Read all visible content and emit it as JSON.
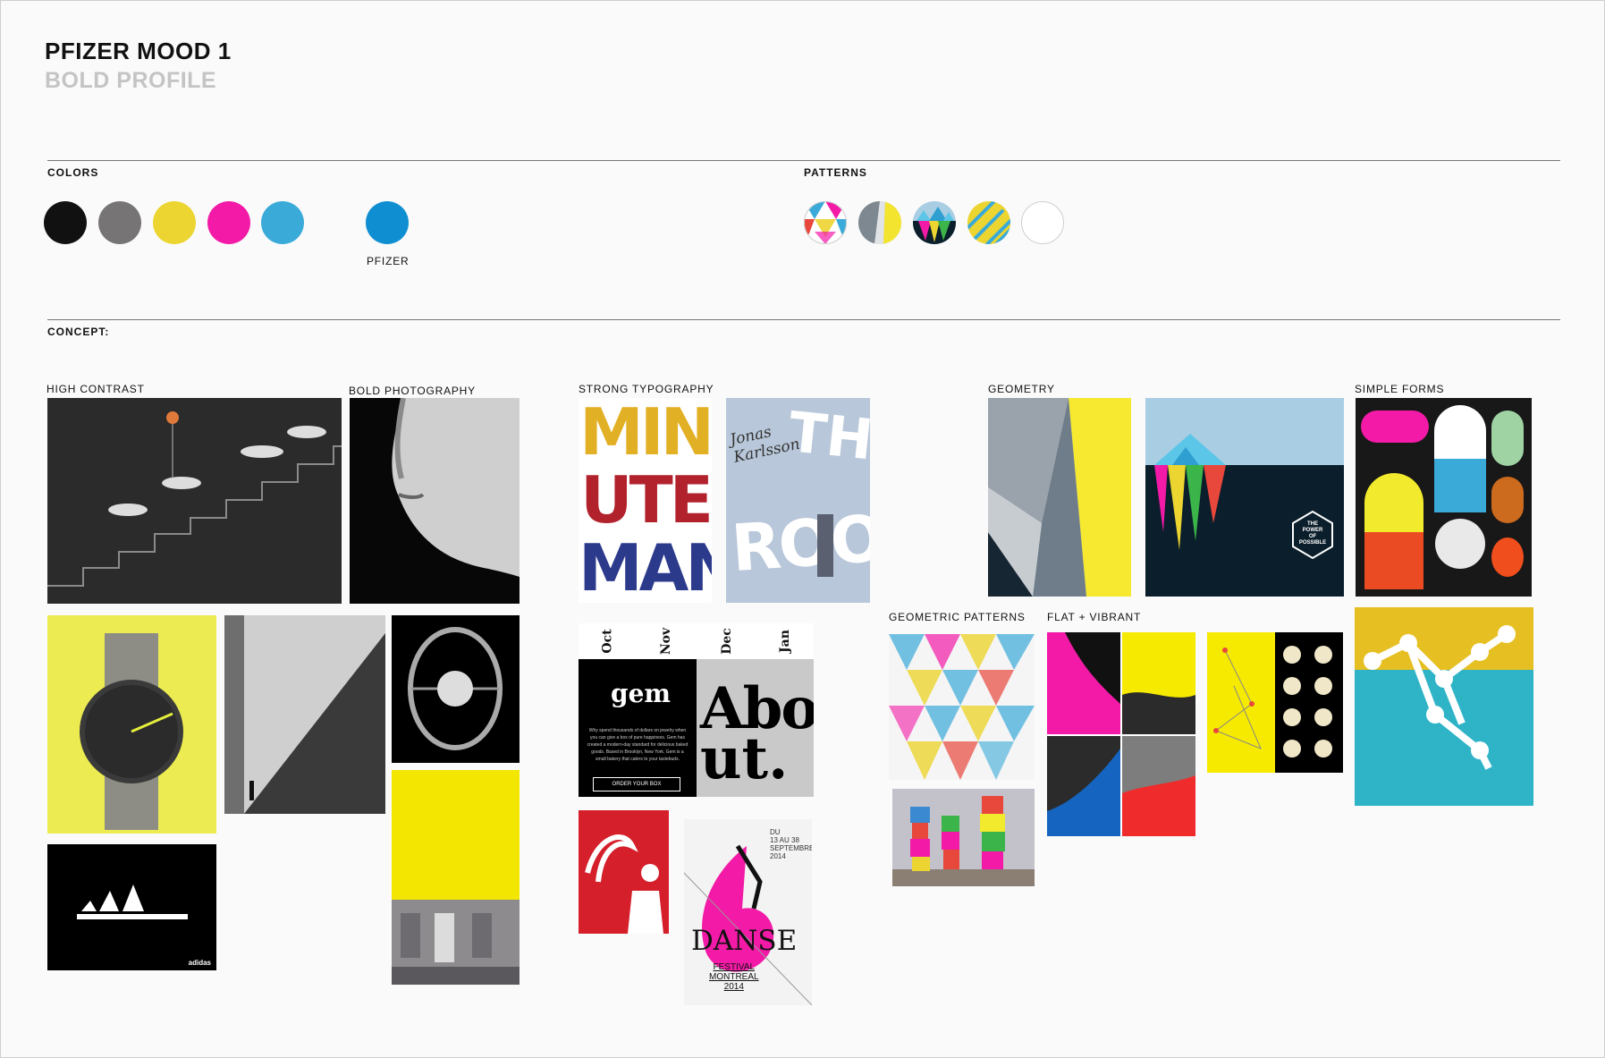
{
  "header": {
    "title": "PFIZER MOOD 1",
    "subtitle": "BOLD PROFILE"
  },
  "sections": {
    "colors": "COLORS",
    "patterns": "PATTERNS",
    "concept": "CONCEPT:"
  },
  "colors": {
    "swatches": [
      "#111111",
      "#767474",
      "#ecd530",
      "#f21aa6",
      "#3aaad9"
    ],
    "brand": {
      "color": "#0f8fd1",
      "label": "PFIZER"
    }
  },
  "patterns": [
    "tri-color-triangles",
    "gray-yellow-split",
    "icebergs",
    "yellow-stripes",
    "blank"
  ],
  "categories": {
    "high_contrast": "HIGH CONTRAST",
    "bold_photography": "BOLD PHOTOGRAPHY",
    "strong_typography": "STRONG TYPOGRAPHY",
    "geometry": "GEOMETRY",
    "simple_forms": "SIMPLE FORMS",
    "geometric_patterns": "GEOMETRIC PATTERNS",
    "flat_vibrant": "FLAT + VIBRANT"
  },
  "images": {
    "minuteman": {
      "line1": "MIN",
      "line2": "UTE",
      "line3": "MAN"
    },
    "room": {
      "author": "Jonas Karlsson",
      "title1": "THE",
      "title2": "ROOM"
    },
    "gem": {
      "months": [
        "Oct",
        "Nov",
        "Dec",
        "Jan"
      ],
      "brand": "gem",
      "body": "Why spend thousands of dollars on jewelry when you can give a box of pure happiness. Gem has created a modern-day standard for delicious baked goods. Based in Brooklyn, New York. Gem is a small bakery that caters to your tastebuds.",
      "button": "ORDER YOUR BOX",
      "about1": "Abo",
      "about2": "ut."
    },
    "danse": {
      "dates": "DU\n13 AU 38\nSEPTEMBRE\n2014",
      "title": "DANSE",
      "festival": "FESTIVAL\nMONTREAL\n2014"
    },
    "iceberg": {
      "badge": "THE\nPOWER\nOF\nPOSSIBLE"
    },
    "adidas": {
      "brand": "adidas"
    }
  }
}
